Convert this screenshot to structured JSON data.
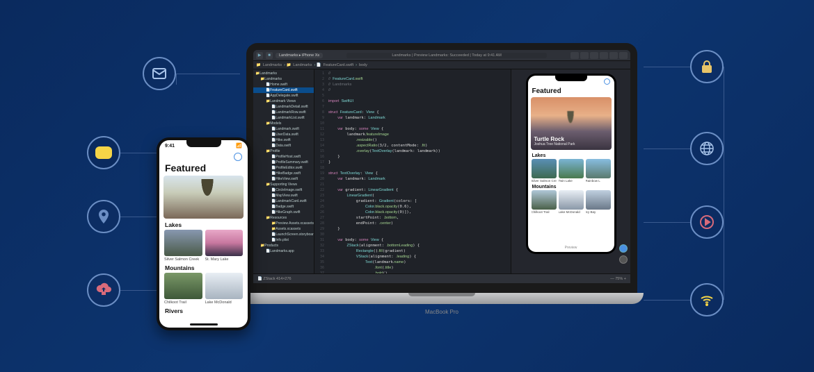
{
  "decor_icons": [
    "mail",
    "chat",
    "pin",
    "cloud-upload",
    "lock",
    "globe",
    "play",
    "wifi"
  ],
  "macbook_label": "MacBook Pro",
  "xcode": {
    "scheme_app": "Landmarks",
    "scheme_device": "iPhone Xs",
    "status": "Landmarks | Preview Landmarks: Succeeded | Today at 9:41 AM",
    "breadcrumb": [
      "Landmarks",
      "Landmarks",
      "FeatureCard.swift",
      "body"
    ],
    "navigator": [
      {
        "t": "Landmarks",
        "k": "fld",
        "i": 0
      },
      {
        "t": "Landmarks",
        "k": "fld",
        "i": 1
      },
      {
        "t": "Home.swift",
        "k": "swf",
        "i": 2
      },
      {
        "t": "FeatureCard.swift",
        "k": "swf",
        "i": 2,
        "sel": true
      },
      {
        "t": "AppDelegate.swift",
        "k": "swf",
        "i": 2
      },
      {
        "t": "Landmark Views",
        "k": "fld",
        "i": 2
      },
      {
        "t": "LandmarkDetail.swift",
        "k": "swf",
        "i": 3
      },
      {
        "t": "LandmarkRow.swift",
        "k": "swf",
        "i": 3
      },
      {
        "t": "LandmarkList.swift",
        "k": "swf",
        "i": 3
      },
      {
        "t": "Models",
        "k": "fld",
        "i": 2
      },
      {
        "t": "Landmark.swift",
        "k": "swf",
        "i": 3
      },
      {
        "t": "UserData.swift",
        "k": "swf",
        "i": 3
      },
      {
        "t": "Hike.swift",
        "k": "swf",
        "i": 3
      },
      {
        "t": "Data.swift",
        "k": "swf",
        "i": 3
      },
      {
        "t": "Profile",
        "k": "fld",
        "i": 2
      },
      {
        "t": "ProfileHost.swift",
        "k": "swf",
        "i": 3
      },
      {
        "t": "ProfileSummary.swift",
        "k": "swf",
        "i": 3
      },
      {
        "t": "ProfileEditor.swift",
        "k": "swf",
        "i": 3
      },
      {
        "t": "HikeBadge.swift",
        "k": "swf",
        "i": 3
      },
      {
        "t": "HikeView.swift",
        "k": "swf",
        "i": 3
      },
      {
        "t": "Supporting Views",
        "k": "fld",
        "i": 2
      },
      {
        "t": "CircleImage.swift",
        "k": "swf",
        "i": 3
      },
      {
        "t": "MapView.swift",
        "k": "swf",
        "i": 3
      },
      {
        "t": "LandmarkCard.swift",
        "k": "swf",
        "i": 3
      },
      {
        "t": "Badge.swift",
        "k": "swf",
        "i": 3
      },
      {
        "t": "HikeGraph.swift",
        "k": "swf",
        "i": 3
      },
      {
        "t": "Resources",
        "k": "fld",
        "i": 2
      },
      {
        "t": "Preview Assets.xcassets",
        "k": "fld",
        "i": 3
      },
      {
        "t": "Assets.xcassets",
        "k": "fld",
        "i": 3
      },
      {
        "t": "LaunchScreen.storyboard",
        "k": "swf",
        "i": 3
      },
      {
        "t": "Info.plist",
        "k": "swf",
        "i": 3
      },
      {
        "t": "Products",
        "k": "fld",
        "i": 1
      },
      {
        "t": "Landmarks.app",
        "k": "swf",
        "i": 2
      }
    ],
    "code_file": "FeatureCard.swift",
    "code_pkg": "Landmarks",
    "code": "//\n//  FeatureCard.swift\n//  Landmarks\n//\n\nimport SwiftUI\n\nstruct FeatureCard: View {\n    var landmark: Landmark\n\n    var body: some View {\n        landmark.featureImage\n            .resizable()\n            .aspectRatio(3/2, contentMode: .fit)\n            .overlay(TextOverlay(landmark: landmark))\n    }\n}\n\nstruct TextOverlay: View {\n    var landmark: Landmark\n\n    var gradient: LinearGradient {\n        LinearGradient(\n            gradient: Gradient(colors: [\n                Color.black.opacity(0.6),\n                Color.black.opacity(0)]),\n            startPoint: .bottom,\n            endPoint: .center)\n    }\n\n    var body: some View {\n        ZStack(alignment: .bottomLeading) {\n            Rectangle().fill(gradient)\n            VStack(alignment: .leading) {\n                Text(landmark.name)\n                    .font(.title)\n                    .bold()\n                Text(landmark.park)\n            }\n            .padding()\n        }\n        .foregroundColor(.white)\n    }\n}",
    "footer_left": "ZStack   414×276",
    "footer_preview": "Preview",
    "footer_zoom": "75%"
  },
  "preview": {
    "title": "Featured",
    "hero_name": "Turtle Rock",
    "hero_park": "Joshua Tree National Park",
    "sections": [
      {
        "name": "Lakes",
        "items": [
          "Silver Salmon Creek",
          "Twin Lake",
          "Rainbow L"
        ]
      },
      {
        "name": "Mountains",
        "items": [
          "Chilkoot Trail",
          "Lake McDonald",
          "Icy Bay"
        ]
      }
    ]
  },
  "phone": {
    "time": "9:41",
    "title": "Featured",
    "sections": [
      {
        "name": "Lakes",
        "items": [
          "Silver Salmon Creek",
          "St. Mary Lake"
        ]
      },
      {
        "name": "Mountains",
        "items": [
          "Chilkoot Trail",
          "Lake McDonald"
        ]
      },
      {
        "name": "Rivers",
        "items": []
      }
    ]
  }
}
